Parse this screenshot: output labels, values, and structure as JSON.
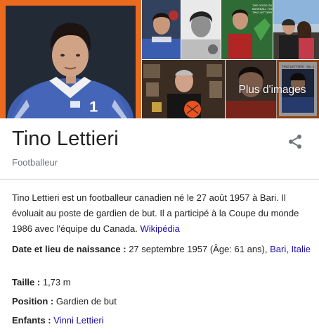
{
  "gallery": {
    "more_images_label": "Plus d'images",
    "accent_color": "#ec6a1d",
    "jersey_number": "1",
    "tile_4_caption": "THE GOOD GUY OF\nBASEBALL TOO\nTINO LETTIERI",
    "tile_8_caption": "TINO LETTIERI · No. 1"
  },
  "header": {
    "title": "Tino Lettieri",
    "subtitle": "Footballeur",
    "share_icon": "share-icon"
  },
  "description": {
    "text": "Tino Lettieri est un footballeur canadien né le 27 août 1957 à Bari. Il évoluait au poste de gardien de but. Il a participé à la Coupe du monde 1986 avec l'équipe du Canada.",
    "source_label": "Wikipédia"
  },
  "facts": {
    "birth": {
      "label": "Date et lieu de naissance :",
      "value": "27 septembre 1957 (Âge: 61 ans),",
      "link1": "Bari",
      "separator": ",",
      "link2": "Italie"
    },
    "height": {
      "label": "Taille :",
      "value": "1,73 m"
    },
    "position": {
      "label": "Position :",
      "value": "Gardien de but"
    },
    "children": {
      "label": "Enfants :",
      "link": "Vinni Lettieri"
    }
  },
  "colors": {
    "link": "#1a0dab",
    "muted": "#70757a",
    "divider": "#dadce0"
  }
}
